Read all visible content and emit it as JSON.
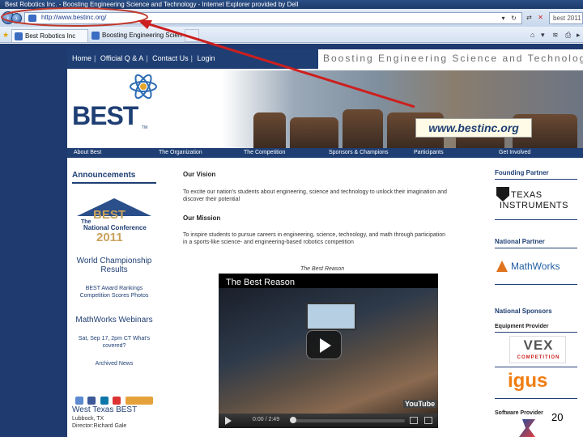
{
  "browser": {
    "title": "Best Robotics Inc. - Boosting Engineering Science and Technology - Internet Explorer provided by Dell",
    "address": "http://www.bestinc.org/",
    "search_placeholder": "best 2011",
    "tabs": [
      {
        "label": "Best Robotics Inc"
      },
      {
        "label": "Boosting Engineering Science"
      }
    ]
  },
  "site": {
    "topnav": [
      "Home",
      "Official Q & A",
      "Contact Us",
      "Login"
    ],
    "tagline": "Boosting Engineering Science and Technology",
    "logo": "BEST",
    "logo_tm": "TM",
    "subnav": [
      "About Best",
      "The Organization",
      "The Competition",
      "Sponsors & Champions",
      "Participants",
      "Get Involved"
    ]
  },
  "callout": {
    "url": "www.bestinc.org",
    "arrow_color": "#cc1f1f"
  },
  "left": {
    "announcements": "Announcements",
    "natconf": {
      "best": "BEST",
      "the": "The",
      "label": "National Conference",
      "year": "2011"
    },
    "world": "World Championship Results",
    "awards": "BEST Award Rankings Competition Scores Photos",
    "mathworks": "MathWorks Webinars",
    "webinar_date": "Sat, Sep 17, 2pm CT What's covered?",
    "archived": "Archived News",
    "hub_title": "West Texas BEST",
    "hub_city": "Lubbock, TX",
    "hub_director": "Director:Richard Gale"
  },
  "mid": {
    "vision_head": "Our Vision",
    "vision_text": "To excite our nation's students about engineering, science and technology to unlock their imagination and discover their potential",
    "mission_head": "Our Mission",
    "mission_text": "To inspire students to pursue careers in engineering, science, technology, and math through participation in a sports-like science- and engineering-based robotics competition",
    "video_caption": "The Best Reason",
    "video_title": "The Best Reason",
    "video_time": "0:00 / 2:49",
    "youtube": "YouTube"
  },
  "right": {
    "founding_head": "Founding Partner",
    "ti_name": "Texas Instruments",
    "national_partner_head": "National Partner",
    "mathworks": "MathWorks",
    "national_sponsors_head": "National Sponsors",
    "equipment": "Equipment Provider",
    "vex": "VEX",
    "vex_sub": "COMPETITION",
    "igus": "igus",
    "software": "Software Provider"
  },
  "slide": {
    "page_number": "20"
  }
}
